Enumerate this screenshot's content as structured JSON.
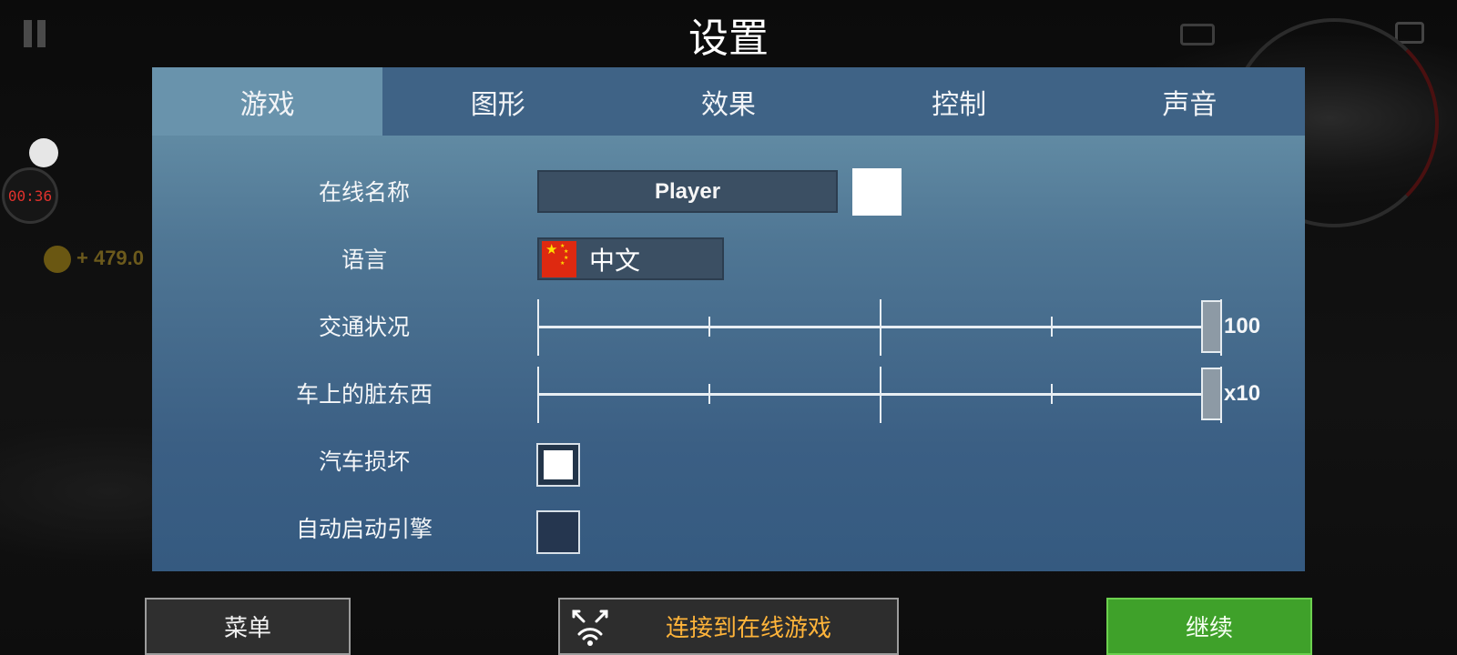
{
  "page": {
    "title": "设置"
  },
  "hud": {
    "timer": "00:36",
    "coins": "+ 479.0"
  },
  "tabs": [
    {
      "label": "游戏",
      "active": true
    },
    {
      "label": "图形",
      "active": false
    },
    {
      "label": "效果",
      "active": false
    },
    {
      "label": "控制",
      "active": false
    },
    {
      "label": "声音",
      "active": false
    }
  ],
  "settings": {
    "online_name": {
      "label": "在线名称",
      "value": "Player",
      "color": "#ffffff"
    },
    "language": {
      "label": "语言",
      "value": "中文",
      "flag": "china-flag-icon"
    },
    "traffic": {
      "label": "交通状况",
      "value_text": "100",
      "fraction": 1.0
    },
    "dirt": {
      "label": "车上的脏东西",
      "value_text": "x10",
      "fraction": 1.0
    },
    "car_damage": {
      "label": "汽车损坏",
      "checked": true
    },
    "auto_engine": {
      "label": "自动启动引擎",
      "checked": false
    }
  },
  "buttons": {
    "menu": "菜单",
    "online": "连接到在线游戏",
    "continue": "继续"
  },
  "colors": {
    "accent_online": "#ffb43a",
    "continue_green": "#3fa12a",
    "tab_active": "#6993ac"
  }
}
